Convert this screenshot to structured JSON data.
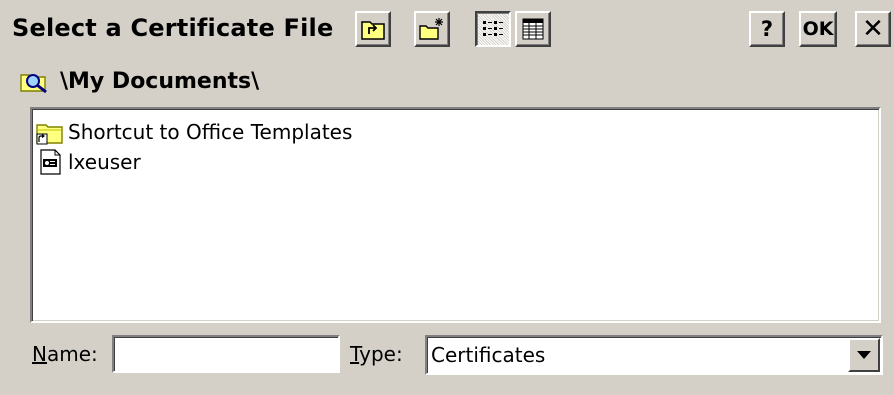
{
  "dialog": {
    "title": "Select a Certificate File",
    "buttons": {
      "help_label": "?",
      "ok_label": "OK",
      "close_label": "✕"
    }
  },
  "path": {
    "current": "\\My Documents\\"
  },
  "files": [
    {
      "name": "Shortcut to Office Templates",
      "icon": "folder-shortcut-icon"
    },
    {
      "name": "lxeuser",
      "icon": "certificate-file-icon"
    }
  ],
  "name_field": {
    "label_accel": "N",
    "label_rest": "ame:",
    "value": ""
  },
  "type_field": {
    "label_accel": "T",
    "label_rest": "ype:",
    "selected": "Certificates"
  },
  "toolbar": {
    "icons": [
      "up-folder-icon",
      "new-folder-icon",
      "list-view-icon",
      "details-view-icon"
    ],
    "active_view": "list-view"
  }
}
